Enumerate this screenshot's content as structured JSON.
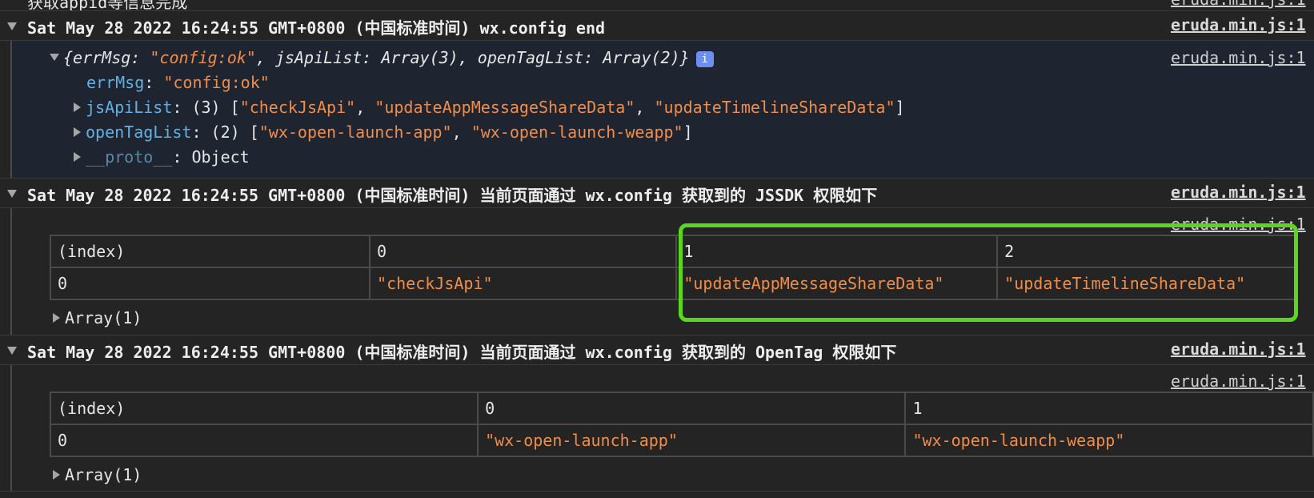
{
  "top_partial": {
    "message": "获取appid等信息完成",
    "source": "eruda.min.js:1"
  },
  "entries": [
    {
      "message": "Sat May 28 2022 16:24:55 GMT+0800 (中国标准时间) wx.config end",
      "source": "eruda.min.js:1",
      "object": {
        "summary_open": "{",
        "summary_errMsg_key": "errMsg: ",
        "summary_errMsg_val": "\"config:ok\"",
        "summary_rest": ", jsApiList: Array(3), openTagList: Array(2)}",
        "source": "eruda.min.js:1",
        "errMsg_key": "errMsg",
        "errMsg_val": "\"config:ok\"",
        "jsApiList_key": "jsApiList",
        "jsApiList_count": "(3) [",
        "jsApiList_items": [
          "\"checkJsApi\"",
          "\"updateAppMessageShareData\"",
          "\"updateTimelineShareData\""
        ],
        "openTagList_key": "openTagList",
        "openTagList_count": "(2) [",
        "openTagList_items": [
          "\"wx-open-launch-app\"",
          "\"wx-open-launch-weapp\""
        ],
        "proto_key": "__proto__",
        "proto_val": "Object",
        "separator": ", ",
        "close": "]",
        "colon": ": "
      }
    },
    {
      "message": "Sat May 28 2022 16:24:55 GMT+0800 (中国标准时间) 当前页面通过 wx.config 获取到的 JSSDK 权限如下",
      "source": "eruda.min.js:1",
      "table_source": "eruda.min.js:1",
      "table": {
        "headers": [
          "(index)",
          "0",
          "1",
          "2"
        ],
        "rows": [
          [
            "0",
            "\"checkJsApi\"",
            "\"updateAppMessageShareData\"",
            "\"updateTimelineShareData\""
          ]
        ]
      },
      "array_label": "Array(1)"
    },
    {
      "message": "Sat May 28 2022 16:24:55 GMT+0800 (中国标准时间) 当前页面通过 wx.config 获取到的 OpenTag 权限如下",
      "source": "eruda.min.js:1",
      "table_source": "eruda.min.js:1",
      "table": {
        "headers": [
          "(index)",
          "0",
          "1"
        ],
        "rows": [
          [
            "0",
            "\"wx-open-launch-app\"",
            "\"wx-open-launch-weapp\""
          ]
        ]
      },
      "array_label": "Array(1)"
    }
  ],
  "info_badge": "i",
  "colors": {
    "background": "#242424",
    "object_background": "#1e2430",
    "key": "#63b0e3",
    "string": "#f08d49",
    "highlight": "#5ad61f",
    "info_badge": "#6d8ff0"
  }
}
